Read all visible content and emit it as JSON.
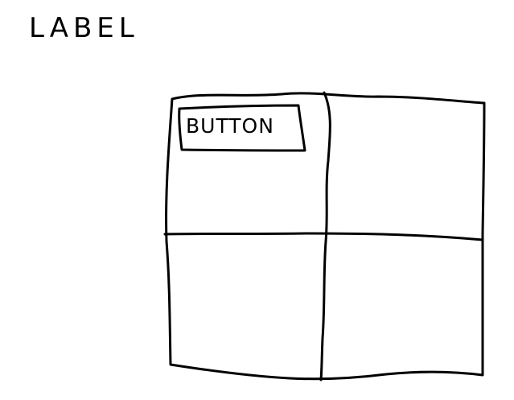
{
  "label": {
    "text": "LABEL"
  },
  "panel": {
    "button_label": "BUTTON"
  },
  "colors": {
    "ink": "#000000",
    "background": "#ffffff"
  }
}
